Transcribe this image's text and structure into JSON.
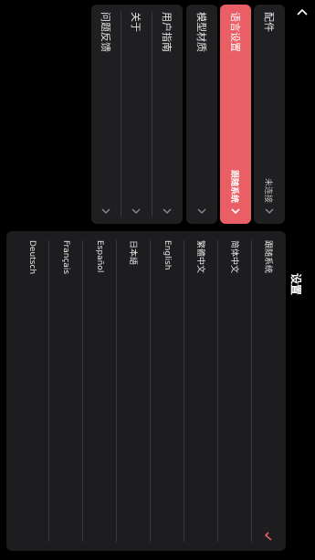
{
  "header": {
    "title": "设置"
  },
  "top_group": [
    {
      "label": "配件",
      "value": "未连接"
    },
    {
      "label": "语言设置",
      "value": "跟随系统"
    },
    {
      "label": "模型材质",
      "value": ""
    },
    {
      "label": "用户指南",
      "value": ""
    },
    {
      "label": "关于",
      "value": ""
    },
    {
      "label": "问题反馈",
      "value": ""
    }
  ],
  "languages": [
    {
      "name": "跟随系统",
      "selected": true
    },
    {
      "name": "简体中文",
      "selected": false
    },
    {
      "name": "繁體中文",
      "selected": false
    },
    {
      "name": "English",
      "selected": false
    },
    {
      "name": "日本語",
      "selected": false
    },
    {
      "name": "Español",
      "selected": false
    },
    {
      "name": "Français",
      "selected": false
    },
    {
      "name": "Deutsch",
      "selected": false
    }
  ],
  "colors": {
    "accent": "#ea5f66",
    "background": "#000000",
    "panel": "#1f1f22"
  },
  "icons": {
    "back": "chevron-up-icon",
    "row_chevron": "chevron-right-icon",
    "selected": "checkmark-icon"
  }
}
